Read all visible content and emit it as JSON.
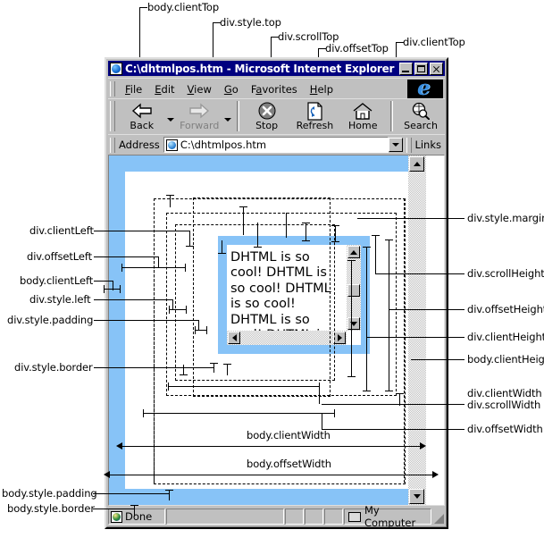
{
  "window": {
    "title": "C:\\dhtmlpos.htm - Microsoft Internet Explorer",
    "title_icon": "globe-document-icon",
    "buttons": {
      "minimize": "minimize-icon",
      "maximize": "maximize-icon",
      "close": "close-icon"
    }
  },
  "menu": {
    "items": [
      {
        "label": "File",
        "accel": "F"
      },
      {
        "label": "Edit",
        "accel": "E"
      },
      {
        "label": "View",
        "accel": "V"
      },
      {
        "label": "Go",
        "accel": "G"
      },
      {
        "label": "Favorites",
        "accel": "a"
      },
      {
        "label": "Help",
        "accel": "H"
      }
    ],
    "logo": "internet-explorer-logo"
  },
  "toolbar": {
    "buttons": [
      {
        "label": "Back",
        "icon": "back-arrow-icon",
        "disabled": false,
        "has_dropdown": true
      },
      {
        "label": "Forward",
        "icon": "forward-arrow-icon",
        "disabled": true,
        "has_dropdown": true
      },
      {
        "label": "Stop",
        "icon": "stop-icon",
        "disabled": false,
        "has_dropdown": false
      },
      {
        "label": "Refresh",
        "icon": "refresh-icon",
        "disabled": false,
        "has_dropdown": false
      },
      {
        "label": "Home",
        "icon": "home-icon",
        "disabled": false,
        "has_dropdown": false
      },
      {
        "label": "Search",
        "icon": "search-icon",
        "disabled": false,
        "has_dropdown": false
      }
    ]
  },
  "address_bar": {
    "label": "Address",
    "value": "C:\\dhtmlpos.htm",
    "icon": "globe-document-icon",
    "dropdown_icon": "chevron-down-icon",
    "links_label": "Links"
  },
  "page": {
    "div_text": "is so cool! DHTML is so cool! DHTML is so cool! DHTML is so cool! DHTML is so cool! DHTML is"
  },
  "status_bar": {
    "message": "Done",
    "zone": "My Computer",
    "zone_icon": "computer-icon",
    "message_icon": "globe-document-icon"
  },
  "annotations": {
    "top": [
      {
        "id": "body-clientTop",
        "text": "body.clientTop"
      },
      {
        "id": "div-styleTop",
        "text": "div.style.top"
      },
      {
        "id": "div-scrollTop",
        "text": "div.scrollTop"
      },
      {
        "id": "div-offsetTop",
        "text": "div.offsetTop"
      },
      {
        "id": "div-clientTop",
        "text": "div.clientTop"
      }
    ],
    "left": [
      {
        "id": "div-clientLeft",
        "text": "div.clientLeft"
      },
      {
        "id": "div-offsetLeft",
        "text": "div.offsetLeft"
      },
      {
        "id": "body-clientLeft",
        "text": "body.clientLeft"
      },
      {
        "id": "div-styleLeft",
        "text": "div.style.left"
      },
      {
        "id": "div-stylePadding",
        "text": "div.style.padding"
      },
      {
        "id": "div-styleBorder",
        "text": "div.style.border"
      },
      {
        "id": "body-stylePadding",
        "text": "body.style.padding"
      },
      {
        "id": "body-styleBorder",
        "text": "body.style.border"
      }
    ],
    "right": [
      {
        "id": "div-styleMargin",
        "text": "div.style.margin"
      },
      {
        "id": "div-scrollHeight",
        "text": "div.scrollHeight"
      },
      {
        "id": "div-offsetHeight",
        "text": "div.offsetHeight"
      },
      {
        "id": "div-clientHeight",
        "text": "div.clientHeight"
      },
      {
        "id": "body-clientHeight",
        "text": "body.clientHeight"
      },
      {
        "id": "div-clientWidth",
        "text": "div.clientWidth"
      },
      {
        "id": "div-scrollWidth",
        "text": "div.scrollWidth"
      },
      {
        "id": "div-offsetWidth",
        "text": "div.offsetWidth"
      }
    ],
    "center": [
      {
        "id": "body-clientWidth",
        "text": "body.clientWidth"
      },
      {
        "id": "body-offsetWidth",
        "text": "body.offsetWidth"
      }
    ]
  },
  "colors": {
    "body_border": "#87c3f7",
    "title_bar": "#000080",
    "chrome": "#c0c0c0",
    "page_bg": "#ffffff",
    "ink": "#000000"
  }
}
